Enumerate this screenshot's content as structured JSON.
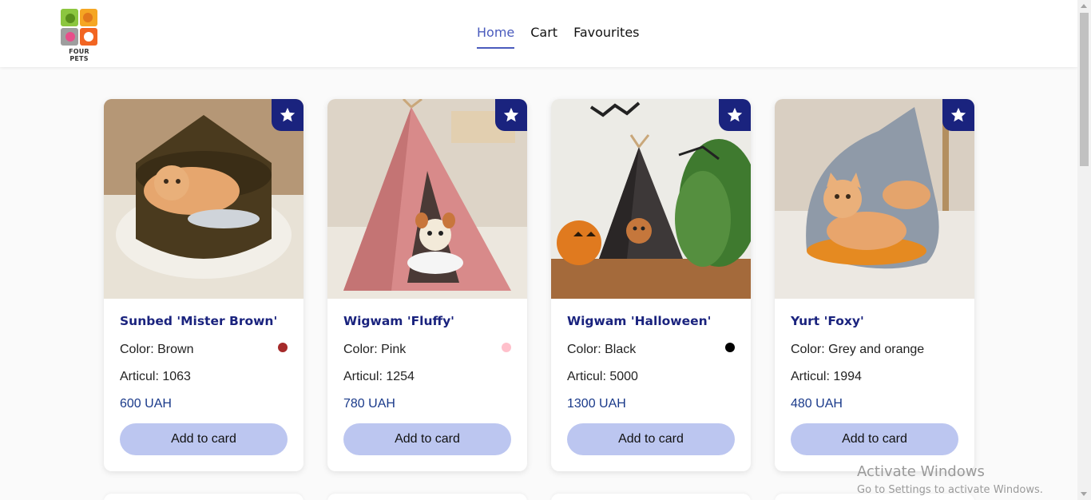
{
  "brand": {
    "name": "FOUR PETS"
  },
  "nav": {
    "items": [
      {
        "label": "Home",
        "active": true
      },
      {
        "label": "Cart",
        "active": false
      },
      {
        "label": "Favourites",
        "active": false
      }
    ]
  },
  "products": [
    {
      "title": "Sunbed 'Mister Brown'",
      "color_label": "Color: Brown",
      "dot_color": "#a52a2a",
      "articul": "Articul: 1063",
      "price": "600 UAH",
      "button": "Add to card"
    },
    {
      "title": "Wigwam 'Fluffy'",
      "color_label": "Color: Pink",
      "dot_color": "#ffc0cb",
      "articul": "Articul: 1254",
      "price": "780 UAH",
      "button": "Add to card"
    },
    {
      "title": "Wigwam 'Halloween'",
      "color_label": "Color: Black",
      "dot_color": "#000000",
      "articul": "Articul: 5000",
      "price": "1300 UAH",
      "button": "Add to card"
    },
    {
      "title": "Yurt 'Foxy'",
      "color_label": "Color: Grey and orange",
      "dot_color": "",
      "articul": "Articul: 1994",
      "price": "480 UAH",
      "button": "Add to card"
    }
  ],
  "watermark": {
    "line1": "Activate Windows",
    "line2": "Go to Settings to activate Windows."
  },
  "colors": {
    "accent": "#4a5bbd",
    "favourite_badge": "#1a237e",
    "button_bg": "#bcc6f0",
    "title": "#1a237e"
  }
}
